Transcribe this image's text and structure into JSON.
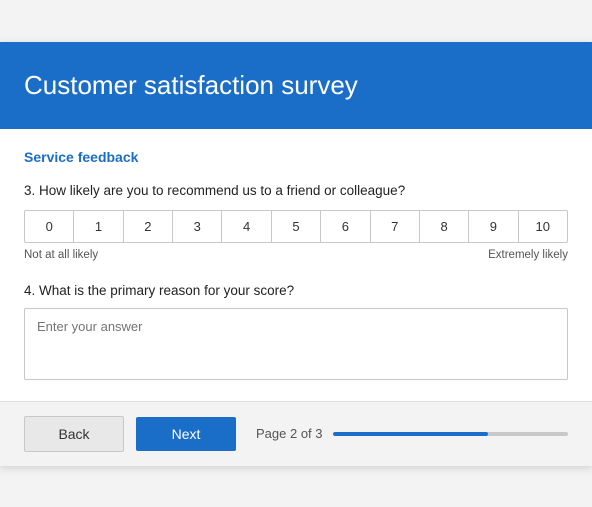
{
  "header": {
    "title": "Customer satisfaction survey"
  },
  "section": {
    "title": "Service feedback"
  },
  "questions": {
    "q3": {
      "label": "3. How likely are you to recommend us to a friend or colleague?",
      "scale": [
        "0",
        "1",
        "2",
        "3",
        "4",
        "5",
        "6",
        "7",
        "8",
        "9",
        "10"
      ],
      "low_label": "Not at all likely",
      "high_label": "Extremely likely"
    },
    "q4": {
      "label": "4. What is the primary reason for your score?",
      "placeholder": "Enter your answer"
    }
  },
  "footer": {
    "back_label": "Back",
    "next_label": "Next",
    "page_label": "Page 2 of 3",
    "progress_percent": 66
  }
}
